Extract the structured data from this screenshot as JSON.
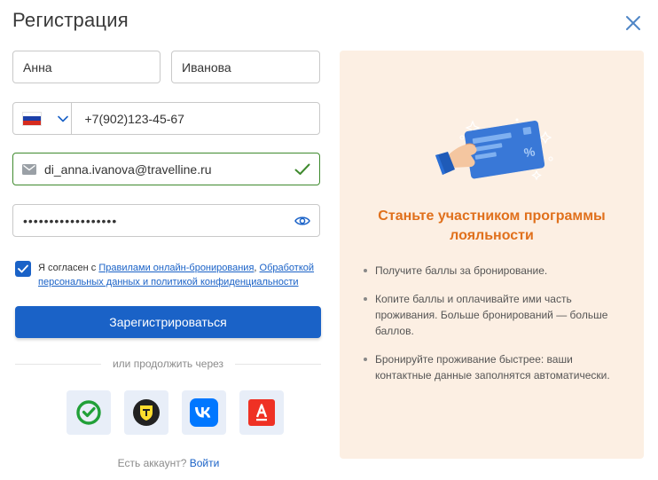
{
  "dialog": {
    "title": "Регистрация"
  },
  "form": {
    "first_name": "Анна",
    "last_name": "Иванова",
    "phone": "+7(902)123-45-67",
    "email": "di_anna.ivanova@travelline.ru",
    "password_mask": "••••••••••••••••••",
    "consent": {
      "prefix": "Я согласен с ",
      "rules_link": "Правилами онлайн-бронирования",
      "separator": ", ",
      "privacy_link": "Обработкой персональных данных и политикой конфиденциальности"
    },
    "register_label": "Зарегистрироваться",
    "divider_text": "или продолжить через",
    "social": [
      "sber-icon",
      "tinkoff-icon",
      "vk-icon",
      "alfa-icon"
    ],
    "login_prompt": "Есть аккаунт?",
    "login_link": "Войти"
  },
  "promo": {
    "title": "Станьте участником программы лояльности",
    "benefits": [
      "Получите баллы за бронирование.",
      "Копите баллы и оплачивайте ими часть проживания. Больше бронирований — больше баллов.",
      "Бронируйте проживание быстрее: ваши контактные данные заполнятся автоматически."
    ]
  },
  "colors": {
    "accent": "#1a62c7",
    "promo_bg": "#fcefe3",
    "promo_title": "#e0701c",
    "valid": "#3f8a2e"
  }
}
